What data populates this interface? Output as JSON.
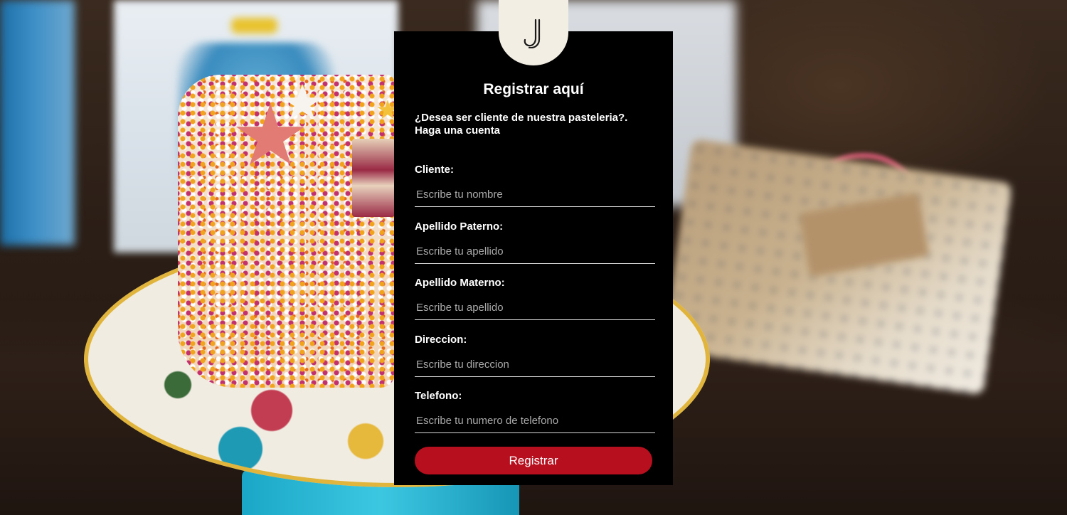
{
  "logo": {
    "icon": "j-monogram-icon",
    "background": "#f3eee4"
  },
  "form": {
    "title": "Registrar aquí",
    "subtitle_line1": "¿Desea ser cliente de nuestra pasteleria?.",
    "subtitle_line2": "Haga una cuenta",
    "fields": [
      {
        "label": "Cliente:",
        "placeholder": "Escribe tu nombre"
      },
      {
        "label": "Apellido Paterno:",
        "placeholder": "Escribe tu apellido"
      },
      {
        "label": "Apellido Materno:",
        "placeholder": "Escribe tu apellido"
      },
      {
        "label": "Direccion:",
        "placeholder": "Escribe tu direccion"
      },
      {
        "label": "Telefono:",
        "placeholder": "Escribe tu numero de telefono"
      }
    ],
    "submit_label": "Registrar"
  },
  "colors": {
    "panel_background": "#000000",
    "accent_button": "#b80f1e",
    "text": "#ffffff",
    "placeholder": "#a9a9a9"
  }
}
